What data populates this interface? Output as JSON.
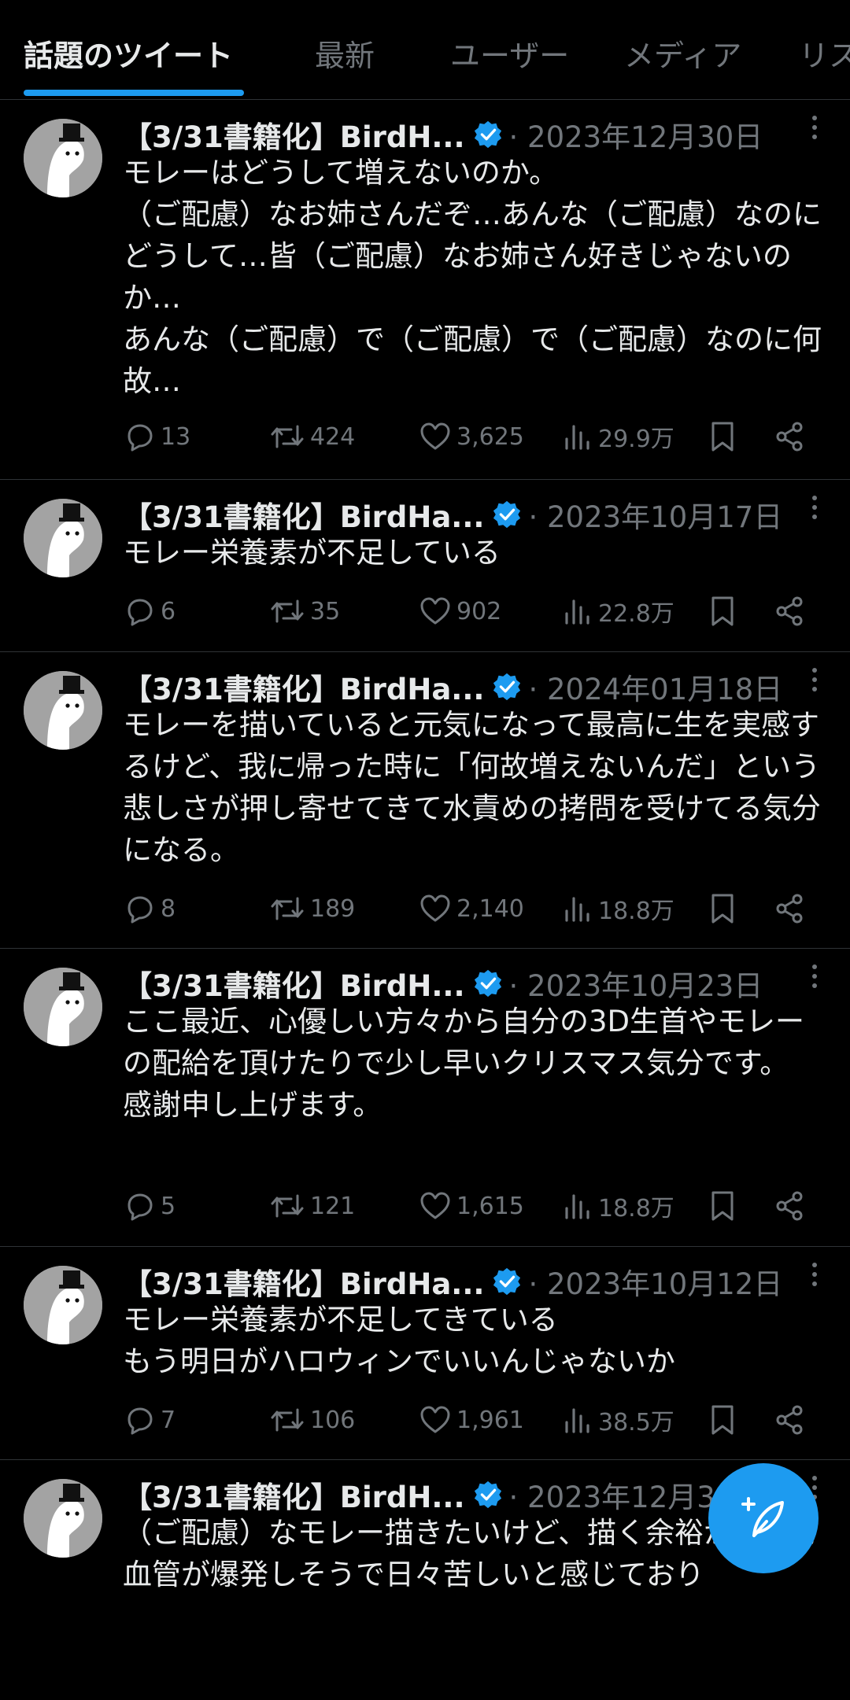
{
  "tabs": [
    {
      "label": "話題のツイート",
      "active": true
    },
    {
      "label": "最新",
      "active": false
    },
    {
      "label": "ユーザー",
      "active": false
    },
    {
      "label": "メディア",
      "active": false
    },
    {
      "label": "リス",
      "active": false
    }
  ],
  "tweets": [
    {
      "name": "【3/31書籍化】BirdH...",
      "date": "· 2023年12月30日",
      "text": "モレーはどうして増えないのか。\n（ご配慮）なお姉さんだぞ…あんな（ご配慮）なのにどうして…皆（ご配慮）なお姉さん好きじゃないのか…\nあんな（ご配慮）で（ご配慮）で（ご配慮）なのに何故…",
      "replies": "13",
      "retweets": "424",
      "likes": "3,625",
      "views": "29.9万"
    },
    {
      "name": "【3/31書籍化】BirdHa...",
      "date": "· 2023年10月17日",
      "text": "モレー栄養素が不足している",
      "replies": "6",
      "retweets": "35",
      "likes": "902",
      "views": "22.8万"
    },
    {
      "name": "【3/31書籍化】BirdHa...",
      "date": "· 2024年01月18日",
      "text": "モレーを描いていると元気になって最高に生を実感するけど、我に帰った時に「何故増えないんだ」という悲しさが押し寄せてきて水責めの拷問を受けてる気分になる。",
      "replies": "8",
      "retweets": "189",
      "likes": "2,140",
      "views": "18.8万"
    },
    {
      "name": "【3/31書籍化】BirdH...",
      "date": "· 2023年10月23日",
      "text": "ここ最近、心優しい方々から自分の3D生首やモレーの配給を頂けたりで少し早いクリスマス気分です。\n感謝申し上げます。",
      "replies": "5",
      "retweets": "121",
      "likes": "1,615",
      "views": "18.8万"
    },
    {
      "name": "【3/31書籍化】BirdHa...",
      "date": "· 2023年10月12日",
      "text": "モレー栄養素が不足してきている\nもう明日がハロウィンでいいんじゃないか",
      "replies": "7",
      "retweets": "106",
      "likes": "1,961",
      "views": "38.5万"
    },
    {
      "name": "【3/31書籍化】BirdH...",
      "date": "· 2023年12月30",
      "text": "（ご配慮）なモレー描きたいけど、描く余裕がなくて血管が爆発しそうで日々苦しいと感じており",
      "replies": "",
      "retweets": "",
      "likes": "",
      "views": ""
    }
  ],
  "colors": {
    "accent": "#1d9bf0",
    "muted": "#71767b",
    "text": "#e7e9ea",
    "divider": "#2f3336"
  },
  "icons": [
    "reply-icon",
    "retweet-icon",
    "like-icon",
    "views-icon",
    "bookmark-icon",
    "share-icon",
    "verified-badge-icon",
    "more-options-icon",
    "compose-tweet-icon"
  ]
}
